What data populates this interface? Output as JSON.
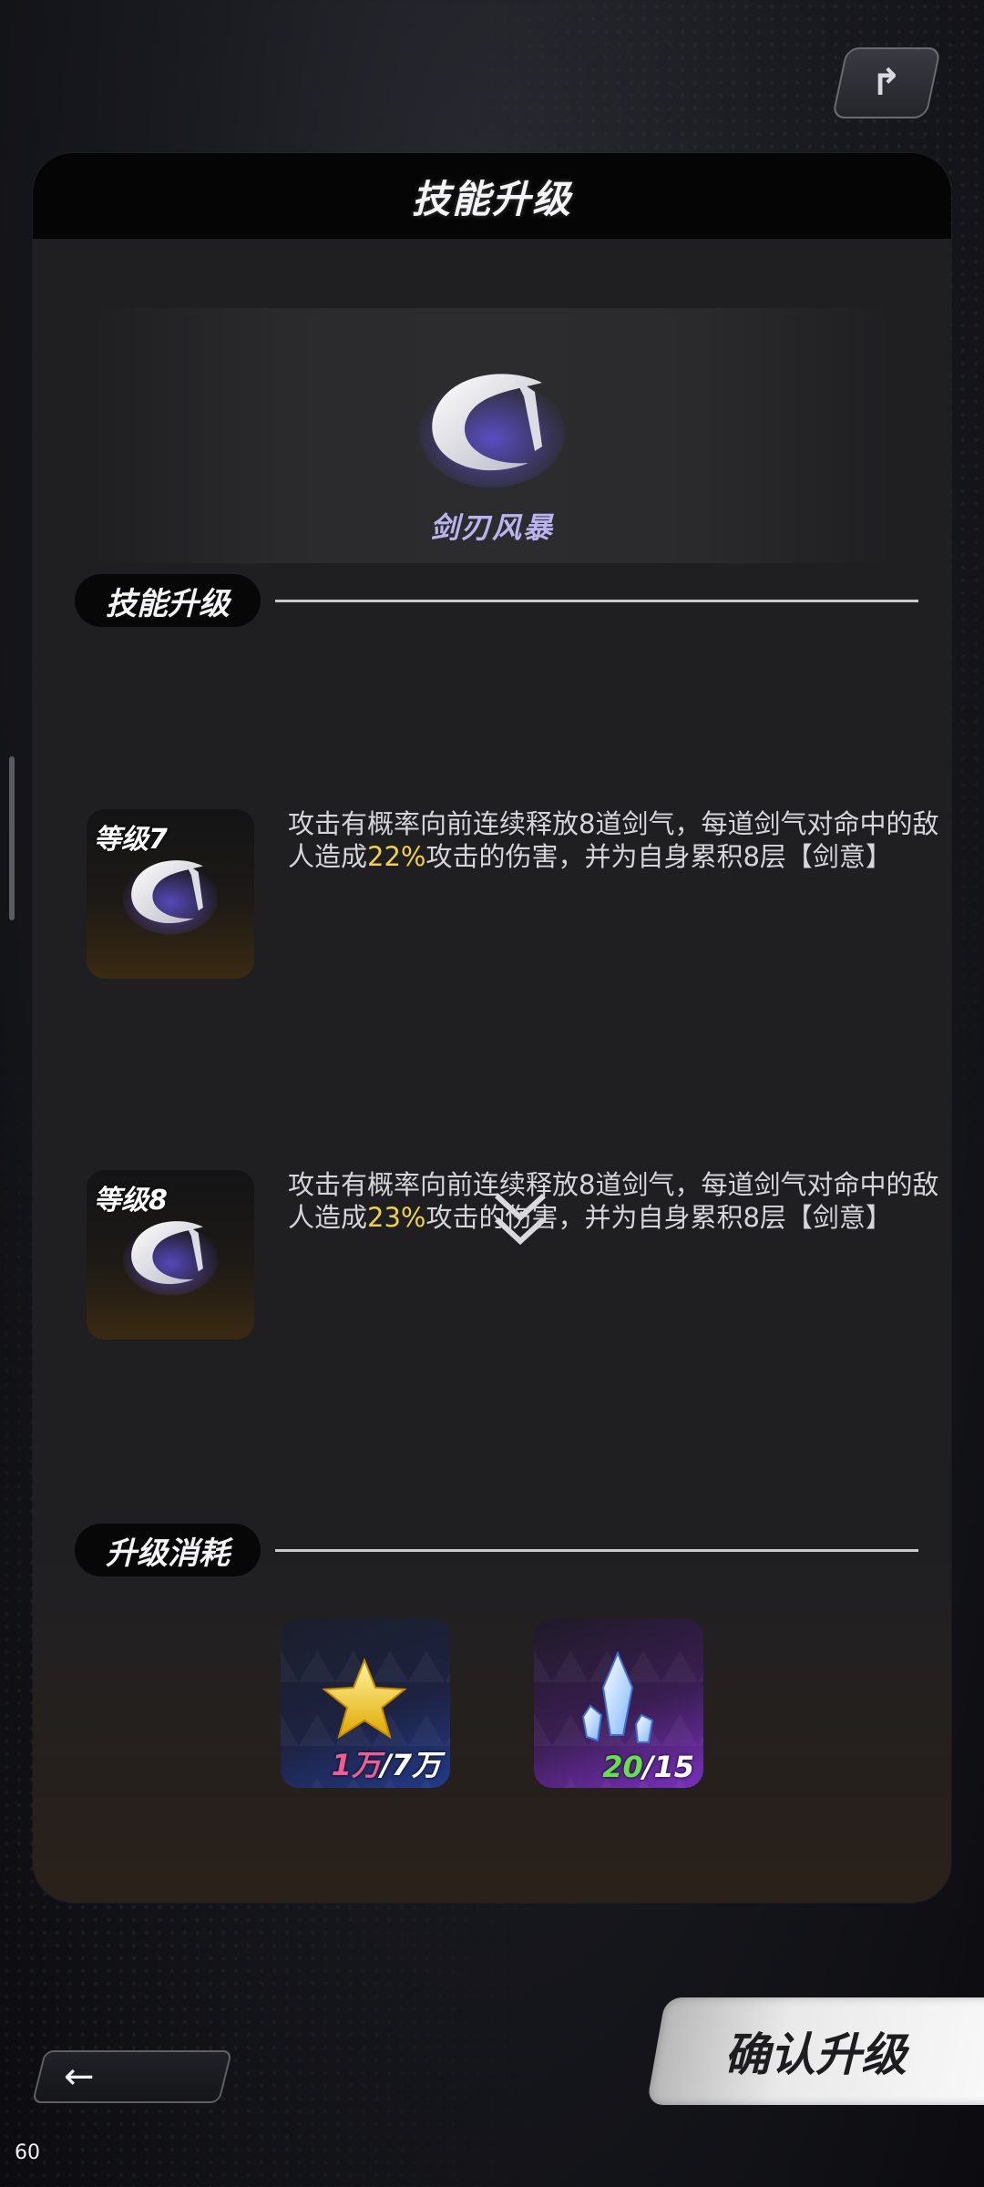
{
  "header": {
    "corner_icon": "skill-tree-icon",
    "title": "技能升级"
  },
  "skill": {
    "name": "剑刃风暴",
    "icon": "crescent-blade-icon"
  },
  "sections": {
    "upgrade_title": "技能升级",
    "cost_title": "升级消耗"
  },
  "levels": [
    {
      "label": "等级7",
      "desc_before": "攻击有概率向前连续释放8道剑气，每道剑气对命中的敌人造成",
      "percent": "22%",
      "desc_after": "攻击的伤害，并为自身累积8层【剑意】"
    },
    {
      "label": "等级8",
      "desc_before": "攻击有概率向前连续释放8道剑气，每道剑气对命中的敌人造成",
      "percent": "23%",
      "desc_after": "攻击的伤害，并为自身累积8层【剑意】"
    }
  ],
  "costs": [
    {
      "item": "gold-star-icon",
      "have": "1万",
      "sep_need": "/7万"
    },
    {
      "item": "crystal-shard-icon",
      "have": "20",
      "sep_need": "/15"
    }
  ],
  "footer": {
    "back_icon": "←",
    "confirm_label": "确认升级"
  },
  "fps": "60",
  "colors": {
    "highlight": "#f2d23d",
    "insufficient": "#ee5d93",
    "sufficient": "#63e04a",
    "skill_name": "#b9b3ee"
  }
}
